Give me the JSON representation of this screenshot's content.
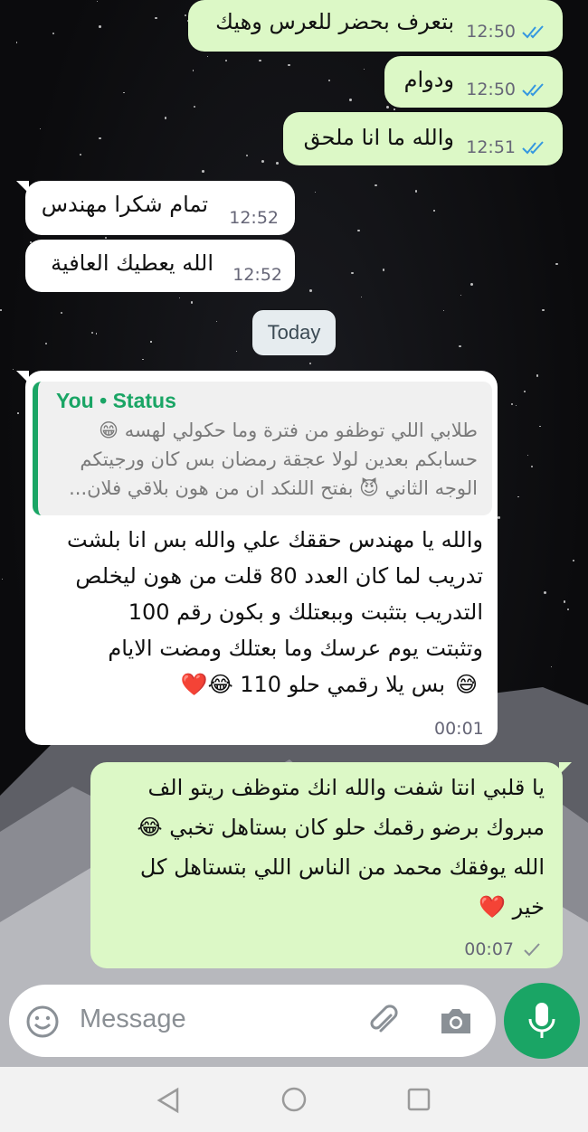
{
  "messages": [
    {
      "dir": "out",
      "text": "بتعرف بحضر للعرس وهيك",
      "time": "12:50",
      "status": "read"
    },
    {
      "dir": "out",
      "text": "ودوام",
      "time": "12:50",
      "status": "read"
    },
    {
      "dir": "out",
      "text": "والله ما انا ملحق",
      "time": "12:51",
      "status": "read"
    },
    {
      "dir": "in",
      "text": "تمام شكرا مهندس",
      "time": "12:52"
    },
    {
      "dir": "in",
      "text": "الله يعطيك العافية",
      "time": "12:52"
    }
  ],
  "date_chip": "Today",
  "reply": {
    "quote_author": "You • Status",
    "quote_lines": [
      "طلابي اللي توظفو من فترة وما حكولي لهسه 😁",
      "حسابكم بعدين لولا عجقة رمضان بس كان ورجيتكم",
      "الوجه الثاني 😈 بفتح اللنكد ان من هون بلاقي فلان..."
    ],
    "lines": [
      "والله يا مهندس حققك علي والله بس انا بلشت",
      "تدريب لما كان العدد 80 قلت من هون ليخلص",
      "التدريب  بتثبت وببعتلك و بكون رقم 100",
      "وتثبتت يوم عرسك وما بعتلك ومضت الايام",
      "بس يلا رقمي حلو 110 😂❤️"
    ],
    "lead_emoji": "😅",
    "time": "00:01"
  },
  "last_message": {
    "lines": [
      "يا قلبي انتا شفت والله انك متوظف ريتو الف",
      "مبروك برضو رقمك حلو كان بستاهل تخبي 😂",
      "الله يوفقك محمد من الناس اللي بتستاهل كل",
      "خير ❤️"
    ],
    "time": "00:07",
    "status": "sent"
  },
  "composer": {
    "placeholder": "Message",
    "emoji_icon": "smiley-icon",
    "attach_icon": "paperclip-icon",
    "camera_icon": "camera-icon",
    "mic_icon": "mic-icon"
  },
  "nav": {
    "back_icon": "triangle-back-icon",
    "home_icon": "circle-home-icon",
    "recents_icon": "square-recents-icon"
  },
  "colors": {
    "outgoing": "#dcf8c6",
    "incoming": "#ffffff",
    "accent": "#1aa565",
    "read_tick": "#3497e0"
  }
}
